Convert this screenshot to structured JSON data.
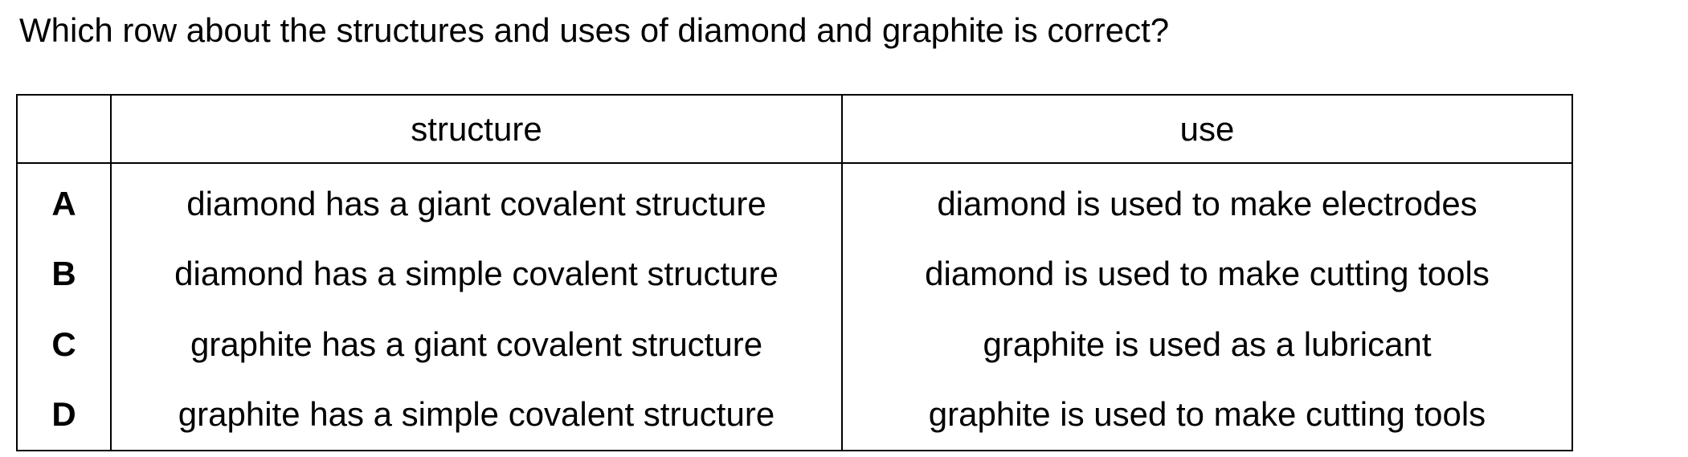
{
  "question": "Which row about the structures and uses of diamond and graphite is correct?",
  "table": {
    "headers": [
      "",
      "structure",
      "use"
    ],
    "rows": [
      {
        "key": "A",
        "structure": "diamond has a giant covalent structure",
        "use": "diamond is used to make electrodes"
      },
      {
        "key": "B",
        "structure": "diamond has a simple covalent structure",
        "use": "diamond is used to make cutting tools"
      },
      {
        "key": "C",
        "structure": "graphite has a giant covalent structure",
        "use": "graphite is used as a lubricant"
      },
      {
        "key": "D",
        "structure": "graphite has a simple covalent structure",
        "use": "graphite is used to make cutting tools"
      }
    ]
  }
}
